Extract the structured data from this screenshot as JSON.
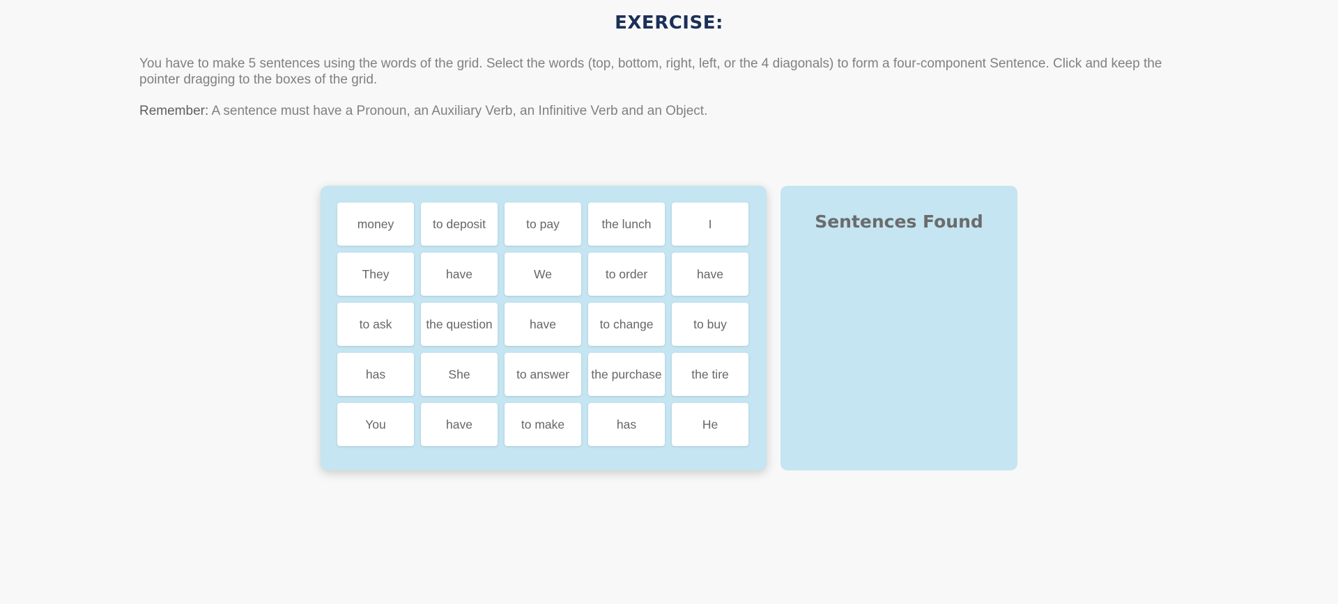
{
  "title": "EXERCISE:",
  "instructions": "You have to make 5 sentences using the words of the grid. Select the words (top, bottom, right, left, or the 4 diagonals) to form a four-component Sentence. Click and keep the pointer dragging to the boxes of the grid.",
  "remember": {
    "label": "Remember:",
    "text": " A sentence must have a Pronoun, an Auxiliary Verb, an Infinitive Verb and an Object."
  },
  "grid": {
    "rows": [
      [
        "money",
        "to deposit",
        "to pay",
        "the lunch",
        "I"
      ],
      [
        "They",
        "have",
        "We",
        "to order",
        "have"
      ],
      [
        "to ask",
        "the question",
        "have",
        "to change",
        "to buy"
      ],
      [
        "has",
        "She",
        "to answer",
        "the purchase",
        "the tire"
      ],
      [
        "You",
        "have",
        "to make",
        "has",
        "He"
      ]
    ]
  },
  "found": {
    "title": "Sentences Found",
    "sentences": []
  }
}
